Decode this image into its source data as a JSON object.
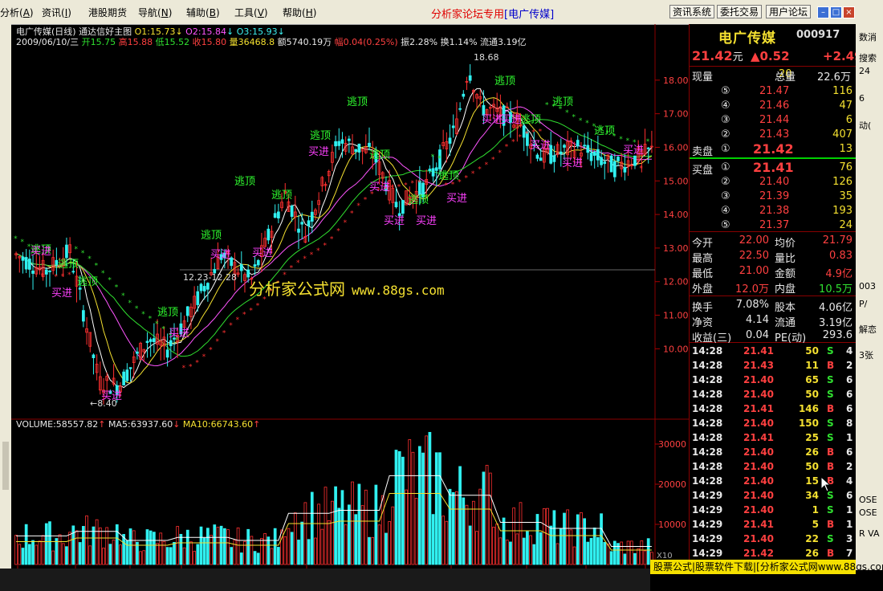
{
  "menubar": {
    "items": [
      {
        "label": "分析",
        "key": "A"
      },
      {
        "label": "资讯",
        "key": "I"
      },
      {
        "label": "港股期货",
        "key": ""
      },
      {
        "label": "导航",
        "key": "N"
      },
      {
        "label": "辅助",
        "key": "B"
      },
      {
        "label": "工具",
        "key": "V"
      },
      {
        "label": "帮助",
        "key": "H"
      }
    ],
    "promo_text": "分析家论坛专用",
    "promo_stock": "[电广传媒]",
    "buttons": [
      "资讯系统",
      "委托交易",
      "用户论坛"
    ]
  },
  "chart": {
    "title_line": "电广传媒(日线) 通达信好主图",
    "o1": "O1:15.73",
    "o2": "O2:15.84",
    "o3": "O3:15.93",
    "date": "2009/06/10/三",
    "open": "开15.75",
    "high": "高15.88",
    "low": "低15.52",
    "close": "收15.80",
    "volume": "量36468.8",
    "amount": "额5740.19万",
    "change": "幅0.04(0.25%)",
    "amplitude": "振2.28%",
    "turnover": "换1.14%",
    "float": "流通3.19亿",
    "peak_label": "18.68",
    "low_label": "←8.40",
    "date_range": "12.23-12.28",
    "watermark_text": "分析家公式网",
    "watermark_url": "www.88gs.com",
    "sell_label": "逃顶",
    "buy_label": "买进",
    "price_ticks": [
      "18.00",
      "17.00",
      "16.00",
      "15.00",
      "14.00",
      "13.00",
      "12.00",
      "11.00",
      "10.00"
    ],
    "vol_info": {
      "volume": "VOLUME:58557.82",
      "ma5": "MA5:63937.60",
      "ma10": "MA10:66743.60"
    },
    "vol_ticks": [
      "30000",
      "20000",
      "10000"
    ],
    "vol_unit": "X10",
    "time_ticks": [
      "2008年",
      "10",
      "11",
      "12",
      "2",
      "3",
      "4",
      "5",
      "6"
    ]
  },
  "chart_data": {
    "type": "candlestick",
    "title": "电广传媒(日线) 通达信好主图",
    "ylim": [
      8.0,
      19.0
    ],
    "x": [
      "2008-10",
      "2008-11",
      "2008-12",
      "2009-01",
      "2009-02",
      "2009-03",
      "2009-04",
      "2009-05",
      "2009-06"
    ],
    "series": [
      {
        "name": "close",
        "values": [
          11.8,
          9.0,
          10.6,
          11.8,
          14.5,
          15.6,
          16.9,
          15.8,
          15.8
        ]
      },
      {
        "name": "high",
        "values": [
          13.3,
          11.4,
          12.4,
          13.7,
          17.2,
          17.6,
          18.68,
          17.3,
          16.3
        ]
      },
      {
        "name": "low",
        "values": [
          11.0,
          8.4,
          9.8,
          11.2,
          12.3,
          13.6,
          15.0,
          15.0,
          15.1
        ]
      }
    ],
    "volume": {
      "ylim": [
        0,
        35000
      ],
      "values": [
        9500,
        11000,
        8000,
        9000,
        8000,
        17000,
        18000,
        29500,
        23000,
        14000,
        12000,
        6000
      ]
    }
  },
  "quote": {
    "name": "电广传媒",
    "code": "000917",
    "price": "21.42",
    "price_unit": "元",
    "change": "▲0.52",
    "change_pct": "+2.49",
    "current_vol_label": "现量",
    "current_vol": "20",
    "total_vol_label": "总量",
    "total_vol": "22.6万",
    "sell_levels": [
      {
        "level": "⑤",
        "price": "21.47",
        "vol": "116"
      },
      {
        "level": "④",
        "price": "21.46",
        "vol": "47"
      },
      {
        "level": "③",
        "price": "21.44",
        "vol": "6"
      },
      {
        "level": "②",
        "price": "21.43",
        "vol": "407"
      }
    ],
    "sell1": {
      "label": "卖盘",
      "level": "①",
      "price": "21.42",
      "vol": "13"
    },
    "buy1": {
      "label": "买盘",
      "level": "①",
      "price": "21.41",
      "vol": "76"
    },
    "buy_levels": [
      {
        "level": "②",
        "price": "21.40",
        "vol": "126"
      },
      {
        "level": "③",
        "price": "21.39",
        "vol": "35"
      },
      {
        "level": "④",
        "price": "21.38",
        "vol": "193"
      },
      {
        "level": "⑤",
        "price": "21.37",
        "vol": "24"
      }
    ],
    "stats": [
      {
        "l1": "今开",
        "v1": "22.00",
        "l2": "均价",
        "v2": "21.79"
      },
      {
        "l1": "最高",
        "v1": "22.50",
        "l2": "量比",
        "v2": "0.83"
      },
      {
        "l1": "最低",
        "v1": "21.00",
        "l2": "金额",
        "v2": "4.9亿"
      },
      {
        "l1": "外盘",
        "v1": "12.0万",
        "l2": "内盘",
        "v2": "10.5万"
      }
    ],
    "fund": [
      {
        "l1": "换手",
        "v1": "7.08%",
        "l2": "股本",
        "v2": "4.06亿"
      },
      {
        "l1": "净资",
        "v1": "4.14",
        "l2": "流通",
        "v2": "3.19亿"
      },
      {
        "l1": "收益(三)",
        "v1": "0.04",
        "l2": "PE(动)",
        "v2": "293.6"
      }
    ],
    "ticks": [
      {
        "t": "14:28",
        "p": "21.41",
        "v": "50",
        "s": "S",
        "n": "4"
      },
      {
        "t": "14:28",
        "p": "21.43",
        "v": "11",
        "s": "B",
        "n": "2"
      },
      {
        "t": "14:28",
        "p": "21.40",
        "v": "65",
        "s": "S",
        "n": "6"
      },
      {
        "t": "14:28",
        "p": "21.40",
        "v": "50",
        "s": "S",
        "n": "6"
      },
      {
        "t": "14:28",
        "p": "21.41",
        "v": "146",
        "s": "B",
        "n": "6"
      },
      {
        "t": "14:28",
        "p": "21.40",
        "v": "150",
        "s": "S",
        "n": "8"
      },
      {
        "t": "14:28",
        "p": "21.41",
        "v": "25",
        "s": "S",
        "n": "1"
      },
      {
        "t": "14:28",
        "p": "21.40",
        "v": "26",
        "s": "B",
        "n": "6"
      },
      {
        "t": "14:28",
        "p": "21.40",
        "v": "50",
        "s": "B",
        "n": "2"
      },
      {
        "t": "14:28",
        "p": "21.40",
        "v": "15",
        "s": "B",
        "n": "4"
      },
      {
        "t": "14:29",
        "p": "21.40",
        "v": "34",
        "s": "S",
        "n": "6"
      },
      {
        "t": "14:29",
        "p": "21.40",
        "v": "1",
        "s": "S",
        "n": "1"
      },
      {
        "t": "14:29",
        "p": "21.41",
        "v": "5",
        "s": "B",
        "n": "1"
      },
      {
        "t": "14:29",
        "p": "21.40",
        "v": "22",
        "s": "S",
        "n": "3"
      },
      {
        "t": "14:29",
        "p": "21.42",
        "v": "26",
        "s": "B",
        "n": "7"
      }
    ]
  },
  "bottom": {
    "ad": "股票公式|股票软件下载|[分析家公式网www.88gs.com]"
  },
  "right_strip": [
    "数消",
    "搜索",
    "24",
    "6",
    "动(",
    "003",
    "P/",
    "解恋",
    "3张",
    "OSE",
    "OSE",
    "R VA",
    "RB O"
  ],
  "colors": {
    "red": "#ff4040",
    "green": "#30e030",
    "yellow": "#f4e030",
    "cyan": "#3cf0f0",
    "magenta": "#ff55ff"
  }
}
